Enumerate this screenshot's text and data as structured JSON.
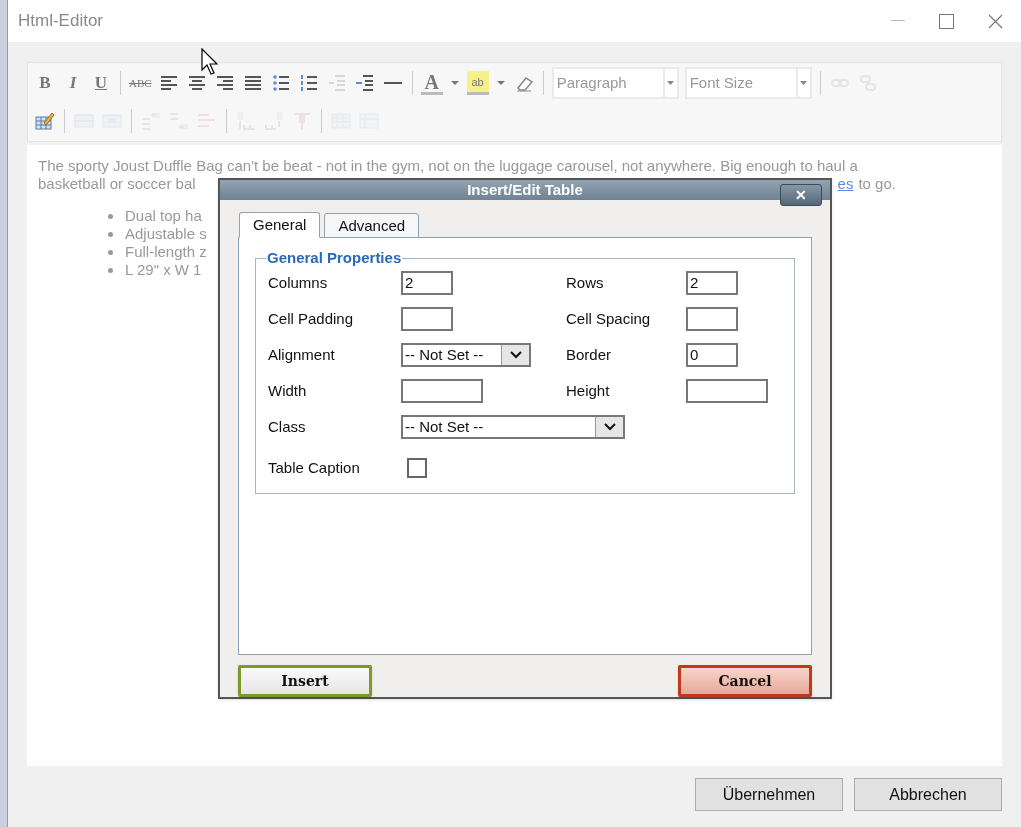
{
  "window": {
    "title": "Html-Editor"
  },
  "toolbar_rows": [
    [
      {
        "kind": "text",
        "label": "B",
        "disabled": false
      },
      {
        "kind": "text",
        "label": "I",
        "disabled": false
      },
      {
        "kind": "text",
        "label": "U",
        "disabled": false
      },
      {
        "kind": "separator"
      },
      {
        "kind": "text",
        "label": "ABC",
        "disabled": false
      },
      {
        "kind": "icon",
        "disabled": false
      },
      {
        "kind": "icon",
        "disabled": false
      },
      {
        "kind": "icon",
        "disabled": false
      },
      {
        "kind": "icon",
        "disabled": false
      },
      {
        "kind": "icon",
        "disabled": false
      },
      {
        "kind": "icon",
        "disabled": false
      },
      {
        "kind": "icon",
        "disabled": true
      },
      {
        "kind": "icon",
        "disabled": false
      },
      {
        "kind": "icon",
        "disabled": false
      },
      {
        "kind": "separator"
      },
      {
        "kind": "text",
        "label": "A",
        "disabled": false
      },
      {
        "kind": "icon",
        "disabled": false
      },
      {
        "kind": "text",
        "label": "ab",
        "disabled": false
      },
      {
        "kind": "icon",
        "disabled": false
      },
      {
        "kind": "icon",
        "disabled": false
      },
      {
        "kind": "separator"
      },
      {
        "kind": "select",
        "placeholder": "Paragraph"
      },
      {
        "kind": "select",
        "placeholder": "Font Size"
      },
      {
        "kind": "separator"
      },
      {
        "kind": "icon",
        "disabled": true
      },
      {
        "kind": "icon",
        "disabled": true
      }
    ],
    [
      {
        "kind": "icon",
        "disabled": false
      },
      {
        "kind": "separator"
      },
      {
        "kind": "icon",
        "disabled": true
      },
      {
        "kind": "icon",
        "disabled": true
      },
      {
        "kind": "separator"
      },
      {
        "kind": "icon",
        "disabled": true
      },
      {
        "kind": "icon",
        "disabled": true
      },
      {
        "kind": "icon",
        "disabled": true
      },
      {
        "kind": "separator"
      },
      {
        "kind": "icon",
        "disabled": true
      },
      {
        "kind": "icon",
        "disabled": true
      },
      {
        "kind": "icon",
        "disabled": true
      },
      {
        "kind": "separator"
      },
      {
        "kind": "icon",
        "disabled": true
      },
      {
        "kind": "icon",
        "disabled": true
      }
    ]
  ],
  "editor": {
    "paragraph_line": "The sporty Joust Duffle Bag can't be beat - not in the gym, not on the luggage carousel, not anywhere. Big enough to haul a",
    "second_line_start": "basketball or soccer bal",
    "link_fragment": "es",
    "second_line_end": "to go.",
    "bullets": [
      "Dual top ha",
      "Adjustable s",
      "Full-length z",
      "L 29\" x W 1"
    ]
  },
  "dialog": {
    "title": "Insert/Edit Table",
    "close": "✕",
    "tabs": [
      {
        "label": "General",
        "selected": true
      },
      {
        "label": "Advanced",
        "selected": false
      }
    ],
    "legend": "General Properties",
    "fields": [
      [
        {
          "label": "Columns",
          "kind": "input",
          "value": "2"
        },
        {
          "label": "Rows",
          "kind": "input",
          "value": "2"
        }
      ],
      [
        {
          "label": "Cell Padding",
          "kind": "input"
        },
        {
          "label": "Cell Spacing",
          "kind": "input"
        }
      ],
      [
        {
          "label": "Alignment",
          "kind": "select",
          "value": "-- Not Set --"
        },
        {
          "label": "Border",
          "kind": "input",
          "value": "0"
        }
      ],
      [
        {
          "label": "Width",
          "kind": "input"
        },
        {
          "label": "Height",
          "kind": "input"
        }
      ],
      [
        {
          "label": "Class",
          "kind": "select",
          "value": "-- Not Set --"
        }
      ],
      [
        {
          "label": "Table Caption",
          "kind": "checkbox",
          "checked": false
        }
      ]
    ],
    "buttons": [
      {
        "label": "Insert",
        "kind": "primary"
      },
      {
        "label": "Cancel",
        "kind": "cancel"
      }
    ]
  },
  "footer_buttons": [
    "Übernehmen",
    "Abbrechen"
  ]
}
